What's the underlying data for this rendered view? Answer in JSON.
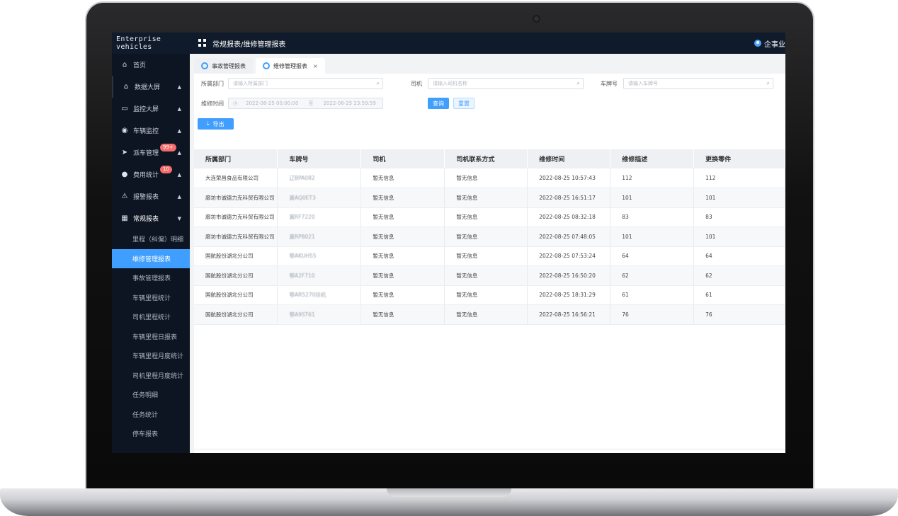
{
  "app": {
    "brand": "Enterprise vehicles",
    "breadcrumb": "常规报表/维修管理报表",
    "user_label": "企事业"
  },
  "sidebar": {
    "items": [
      {
        "label": "首页",
        "icon": "home-icon",
        "glyph": "⌂"
      },
      {
        "label": "数据大屏",
        "icon": "home-icon",
        "glyph": "⌂",
        "arrow": "▲"
      },
      {
        "label": "监控大屏",
        "icon": "monitor-icon",
        "glyph": "▭",
        "arrow": "▲"
      },
      {
        "label": "车辆监控",
        "icon": "location-pin-icon",
        "glyph": "◉",
        "arrow": "▲"
      },
      {
        "label": "派车管理",
        "icon": "send-icon",
        "glyph": "➤",
        "arrow": "▲",
        "badge": "99+"
      },
      {
        "label": "费用统计",
        "icon": "user-icon",
        "glyph": "●",
        "arrow": "▲",
        "badge": "10"
      },
      {
        "label": "报警报表",
        "icon": "alarm-icon",
        "glyph": "⚠",
        "arrow": "▲"
      },
      {
        "label": "常规报表",
        "icon": "grid-icon",
        "glyph": "▦",
        "arrow": "▼"
      }
    ],
    "sub_items": [
      "里程（纠偏）明细",
      "维修管理报表",
      "事故管理报表",
      "车辆里程统计",
      "司机里程统计",
      "车辆里程日报表",
      "车辆里程月度统计",
      "司机里程月度统计",
      "任务明细",
      "任务统计",
      "停车报表"
    ],
    "selected_sub": "维修管理报表"
  },
  "tabs": [
    {
      "label": "事故管理报表",
      "active": false
    },
    {
      "label": "维修管理报表",
      "active": true,
      "close": "×"
    }
  ],
  "filters": {
    "dept_label": "所属部门",
    "dept_placeholder": "请输入所属部门",
    "driver_label": "司机",
    "driver_placeholder": "请输入司机名称",
    "plate_label": "车牌号",
    "plate_placeholder": "请输入车牌号",
    "time_label": "维修时间",
    "time_start": "2022-08-25 00:00:00",
    "time_sep": "至",
    "time_end": "2022-08-25 23:59:59",
    "query_button": "查询",
    "reset_button": "重置",
    "export_button": "导出"
  },
  "table": {
    "headers": [
      "所属部门",
      "车牌号",
      "司机",
      "司机联系方式",
      "维修时间",
      "维修描述",
      "更换零件"
    ],
    "rows": [
      [
        "大连荣昌食品有限公司",
        "辽BPA082",
        "暂无信息",
        "暂无信息",
        "2022-08-25 10:57:43",
        "112",
        "112"
      ],
      [
        "廊坊市诚德力克科贸有限公司",
        "冀AQ0ET3",
        "暂无信息",
        "暂无信息",
        "2022-08-25 16:51:17",
        "101",
        "101"
      ],
      [
        "廊坊市诚德力克科贸有限公司",
        "冀RF7220",
        "暂无信息",
        "暂无信息",
        "2022-08-25 08:32:18",
        "83",
        "83"
      ],
      [
        "廊坊市诚德力克科贸有限公司",
        "冀RP8021",
        "暂无信息",
        "暂无信息",
        "2022-08-25 07:48:05",
        "101",
        "101"
      ],
      [
        "国航股份湖北分公司",
        "鄂AKUH55",
        "暂无信息",
        "暂无信息",
        "2022-08-25 07:53:24",
        "64",
        "64"
      ],
      [
        "国航股份湖北分公司",
        "鄂A2F710",
        "暂无信息",
        "暂无信息",
        "2022-08-25 16:50:20",
        "62",
        "62"
      ],
      [
        "国航股份湖北分公司",
        "鄂AR5270挂机",
        "暂无信息",
        "暂无信息",
        "2022-08-25 18:31:29",
        "61",
        "61"
      ],
      [
        "国航股份湖北分公司",
        "鄂A9ST61",
        "暂无信息",
        "暂无信息",
        "2022-08-25 16:56:21",
        "76",
        "76"
      ]
    ]
  },
  "colors": {
    "accent": "#409eff",
    "sidebar_bg": "#0e1522",
    "topbar_bg": "#0f1a2b",
    "badge": "#f56c6c"
  }
}
